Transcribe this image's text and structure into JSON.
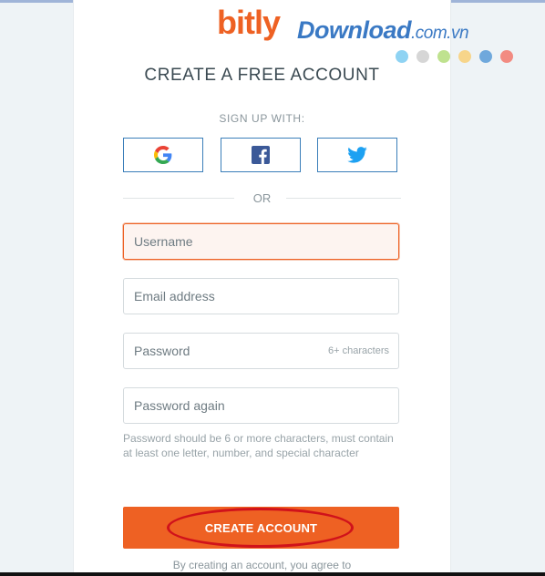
{
  "watermark": {
    "brand": "bitly",
    "site": "Download",
    "suffix": ".com.vn",
    "dot_colors": [
      "#8fd3f3",
      "#d6d6d6",
      "#bfe28f",
      "#f7d58a",
      "#6fa8dc",
      "#f28b82"
    ]
  },
  "form": {
    "title": "CREATE A FREE ACCOUNT",
    "signup_with": "SIGN UP WITH:",
    "social": [
      {
        "name": "google",
        "icon": "google-icon"
      },
      {
        "name": "facebook",
        "icon": "facebook-icon"
      },
      {
        "name": "twitter",
        "icon": "twitter-icon"
      }
    ],
    "or": "OR",
    "username_placeholder": "Username",
    "email_placeholder": "Email address",
    "password_placeholder": "Password",
    "password_hint": "6+ characters",
    "password_again_placeholder": "Password again",
    "password_note": "Password should be 6 or more characters, must contain at least one letter, number, and special character",
    "submit_label": "CREATE ACCOUNT",
    "terms": "By creating an account, you agree to"
  },
  "colors": {
    "accent": "#ee6123",
    "social_border": "#3a7eb9",
    "annotation_oval": "#d0121b"
  }
}
